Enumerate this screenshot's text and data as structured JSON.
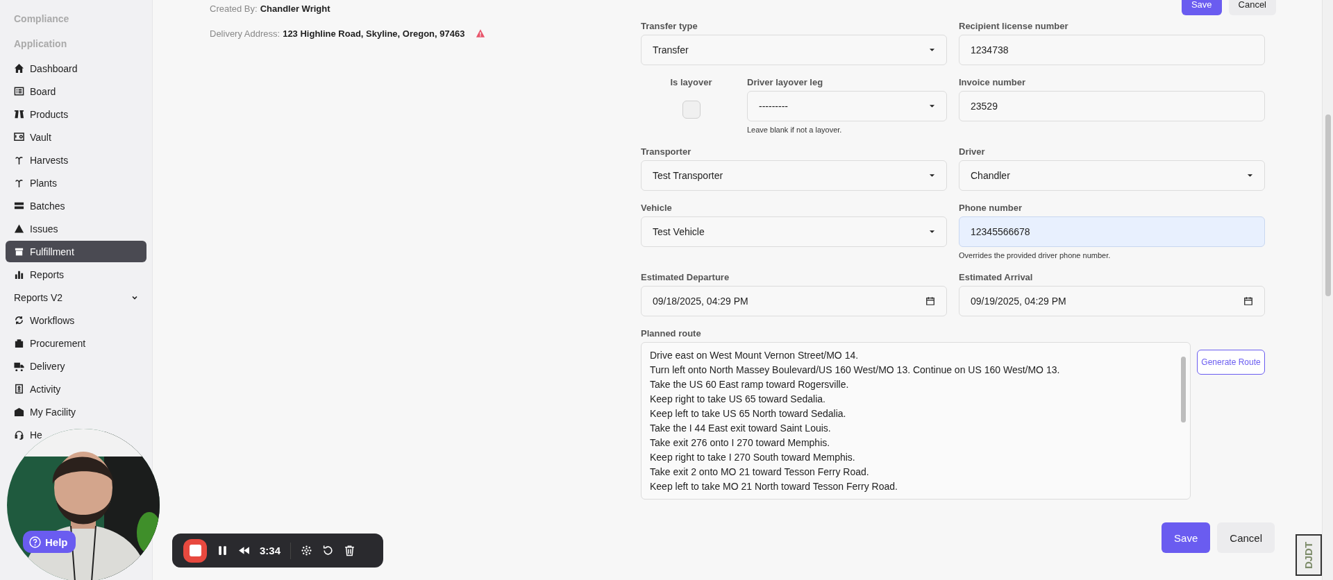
{
  "sidebar": {
    "headings": [
      "Compliance",
      "Application"
    ],
    "items": [
      {
        "kind": "link",
        "label": "Dashboard",
        "selected": false
      },
      {
        "kind": "link",
        "label": "Board",
        "selected": false
      },
      {
        "kind": "link",
        "label": "Products",
        "selected": false
      },
      {
        "kind": "link",
        "label": "Vault",
        "selected": false
      },
      {
        "kind": "link",
        "label": "Harvests",
        "selected": false
      },
      {
        "kind": "link",
        "label": "Plants",
        "selected": false
      },
      {
        "kind": "link",
        "label": "Batches",
        "selected": false
      },
      {
        "kind": "link",
        "label": "Issues",
        "selected": false
      },
      {
        "kind": "link",
        "label": "Fulfillment",
        "selected": true
      },
      {
        "kind": "link",
        "label": "Reports",
        "selected": false
      },
      {
        "kind": "group",
        "label": "Reports V2",
        "selected": false
      },
      {
        "kind": "link",
        "label": "Workflows",
        "selected": false
      },
      {
        "kind": "link",
        "label": "Procurement",
        "selected": false
      },
      {
        "kind": "link",
        "label": "Delivery",
        "selected": false
      },
      {
        "kind": "link",
        "label": "Activity",
        "selected": false
      },
      {
        "kind": "link",
        "label": "My Facility",
        "selected": false
      },
      {
        "kind": "link",
        "label": "He",
        "selected": false
      }
    ]
  },
  "header": {
    "created_by": {
      "label": "Created By:",
      "value": "Chandler Wright"
    },
    "delivery_address": {
      "label": "Delivery Address:",
      "value": "123 Highline Road, Skyline, Oregon, 97463",
      "warning": true
    }
  },
  "top_actions": [
    {
      "kind": "primary",
      "label": "Save"
    },
    {
      "kind": "secondary",
      "label": "Cancel"
    }
  ],
  "form": {
    "rows": [
      [
        {
          "kind": "select",
          "label": "Transfer type",
          "value": "Transfer"
        },
        {
          "kind": "text",
          "label": "Recipient license number",
          "value": "1234738"
        }
      ],
      [
        {
          "kind": "layover",
          "checkbox": {
            "label": "Is layover",
            "checked": false
          },
          "field": {
            "label": "Driver layover leg",
            "value": "---------",
            "helper": "Leave blank if not a layover."
          }
        },
        {
          "kind": "text",
          "label": "Invoice number",
          "value": "23529"
        }
      ],
      [
        {
          "kind": "select",
          "label": "Transporter",
          "value": "Test Transporter"
        },
        {
          "kind": "select",
          "label": "Driver",
          "value": "Chandler"
        }
      ],
      [
        {
          "kind": "select",
          "label": "Vehicle",
          "value": "Test Vehicle"
        },
        {
          "kind": "text",
          "label": "Phone number",
          "value": "12345566678",
          "autofilled": true,
          "helper": "Overrides the provided driver phone number."
        }
      ],
      [
        {
          "kind": "date",
          "label": "Estimated Departure",
          "value": "09/18/2025, 04:29 PM"
        },
        {
          "kind": "date",
          "label": "Estimated Arrival",
          "value": "09/19/2025, 04:29 PM"
        }
      ],
      [
        {
          "kind": "route",
          "label": "Planned route",
          "button": "Generate Route",
          "lines": [
            "Drive east on West Mount Vernon Street/MO 14.",
            "Turn left onto North Massey Boulevard/US 160 West/MO 13. Continue on US 160 West/MO 13.",
            "Take the US 60 East ramp toward Rogersville.",
            "Keep right to take US 65 toward Sedalia.",
            "Keep left to take US 65 North toward Sedalia.",
            "Take the I 44 East exit toward Saint Louis.",
            "Take exit 276 onto I 270 toward Memphis.",
            "Keep right to take I 270 South toward Memphis.",
            "Take exit 2 onto MO 21 toward Tesson Ferry Road.",
            "Keep left to take MO 21 North toward Tesson Ferry Road."
          ]
        }
      ]
    ]
  },
  "bottom_actions": [
    {
      "kind": "primary",
      "label": "Save"
    },
    {
      "kind": "secondary",
      "label": "Cancel"
    }
  ],
  "help": {
    "label": "Help"
  },
  "recorder": {
    "time": "3:34"
  },
  "debug_toolbar": {
    "label": "DJDT"
  }
}
